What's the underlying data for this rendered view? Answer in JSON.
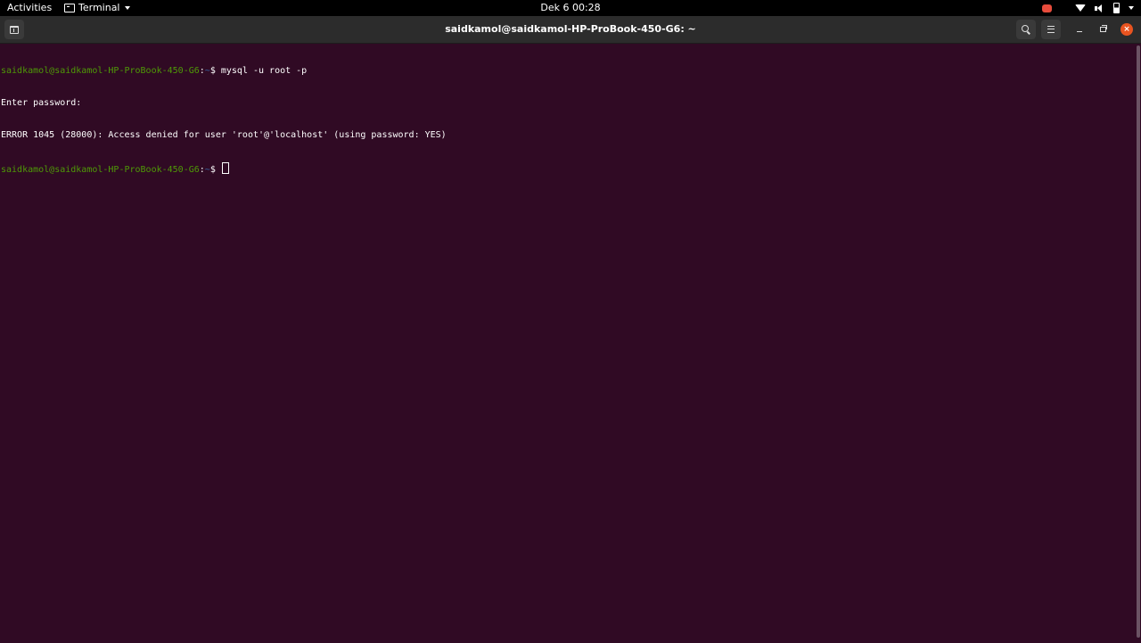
{
  "topbar": {
    "activities_label": "Activities",
    "app_menu_label": "Terminal",
    "clock": "Dek 6  00:28",
    "tray_icons": [
      "screen-record-icon",
      "wifi-icon",
      "volume-icon",
      "battery-icon",
      "system-menu-caret-icon"
    ]
  },
  "window": {
    "title": "saidkamol@saidkamol-HP-ProBook-450-G6: ~",
    "new_tab_icon": "new-tab-icon",
    "search_icon": "search-icon",
    "menu_icon": "hamburger-menu-icon",
    "minimize_icon": "minimize-icon",
    "restore_icon": "restore-icon",
    "close_glyph": "×",
    "colors": {
      "background": "#300a24",
      "prompt_user": "#4e9a06",
      "prompt_path": "#3465a4",
      "text": "#ffffff",
      "close_button": "#e95420"
    }
  },
  "terminal": {
    "prompt_user_host": "saidkamol@saidkamol-HP-ProBook-450-G6",
    "prompt_colon": ":",
    "prompt_path": "~",
    "prompt_symbol": "$ ",
    "lines": [
      {
        "type": "command",
        "command": "mysql -u root -p"
      },
      {
        "type": "output",
        "text": "Enter password:"
      },
      {
        "type": "output",
        "text": "ERROR 1045 (28000): Access denied for user 'root'@'localhost' (using password: YES)"
      },
      {
        "type": "prompt",
        "command": ""
      }
    ]
  }
}
